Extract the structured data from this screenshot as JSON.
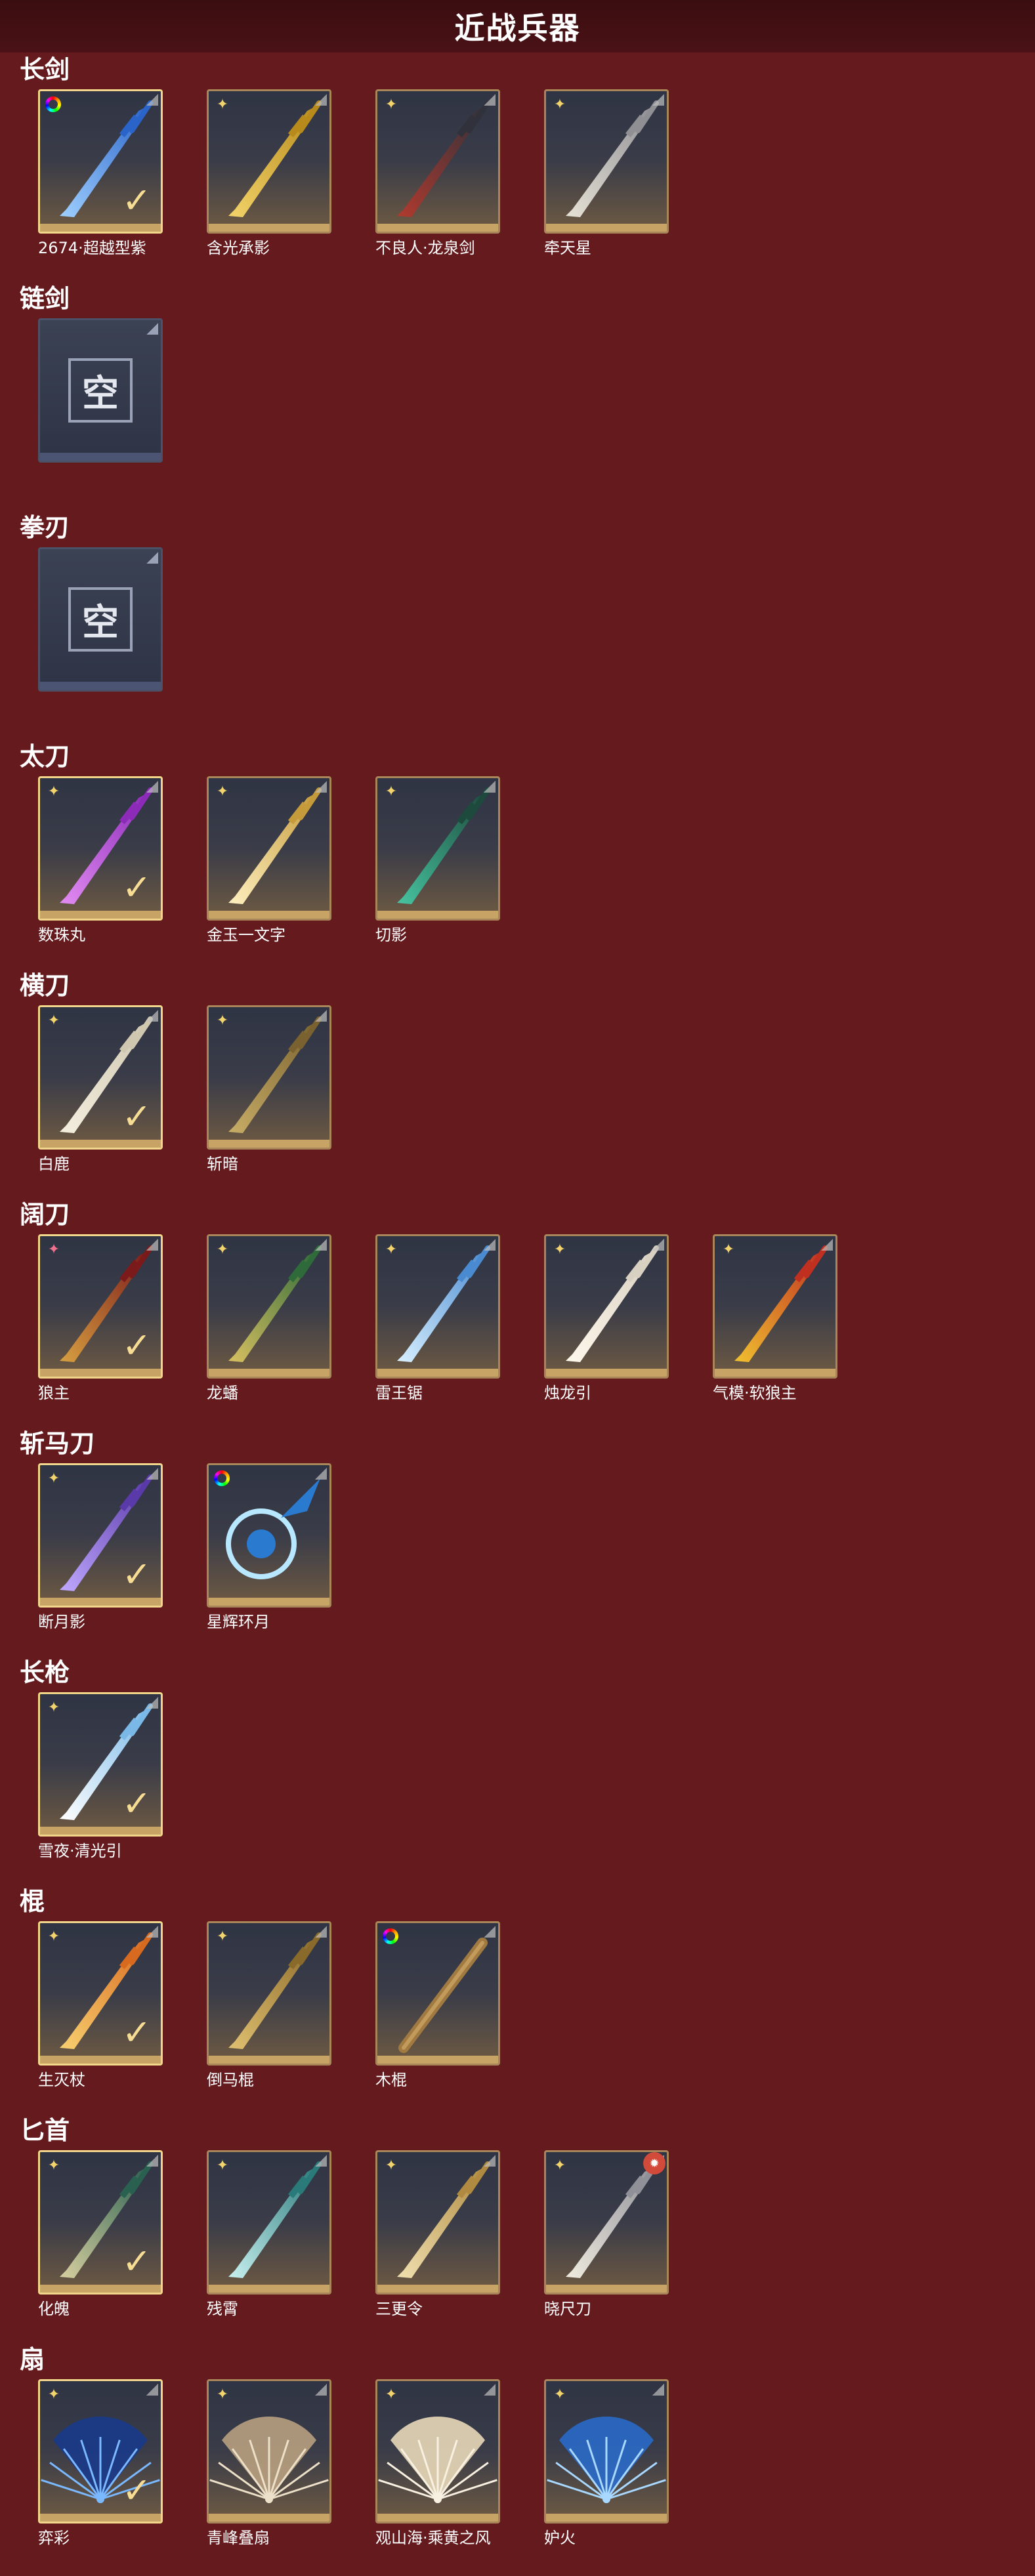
{
  "title": "近战兵器",
  "categories": [
    {
      "name": "长剑",
      "items": [
        {
          "label": "2674·超越型紫",
          "rarity": "rainbow",
          "equipped": true,
          "art": "blue-sword"
        },
        {
          "label": "含光承影",
          "rarity": "gold",
          "equipped": false,
          "art": "gold-sword"
        },
        {
          "label": "不良人·龙泉剑",
          "rarity": "gold",
          "equipped": false,
          "art": "dark-sword"
        },
        {
          "label": "牵天星",
          "rarity": "gold",
          "equipped": false,
          "art": "silver-sword"
        }
      ]
    },
    {
      "name": "链剑",
      "empty_label": "空",
      "items": []
    },
    {
      "name": "拳刃",
      "empty_label": "空",
      "items": []
    },
    {
      "name": "太刀",
      "items": [
        {
          "label": "数珠丸",
          "rarity": "gold",
          "equipped": true,
          "art": "purple-katana"
        },
        {
          "label": "金玉一文字",
          "rarity": "gold",
          "equipped": false,
          "art": "gold-katana"
        },
        {
          "label": "切影",
          "rarity": "gold",
          "equipped": false,
          "art": "green-katana"
        }
      ]
    },
    {
      "name": "横刀",
      "items": [
        {
          "label": "白鹿",
          "rarity": "gold",
          "equipped": true,
          "art": "white-saber"
        },
        {
          "label": "斩暗",
          "rarity": "gold",
          "equipped": false,
          "art": "bronze-saber"
        }
      ]
    },
    {
      "name": "阔刀",
      "items": [
        {
          "label": "狼主",
          "rarity": "pink",
          "equipped": true,
          "art": "red-broad"
        },
        {
          "label": "龙蟠",
          "rarity": "gold",
          "equipped": false,
          "art": "green-broad"
        },
        {
          "label": "雷王锯",
          "rarity": "gold",
          "equipped": false,
          "art": "blue-broad"
        },
        {
          "label": "烛龙引",
          "rarity": "gold",
          "equipped": false,
          "art": "white-broad"
        },
        {
          "label": "气模·软狼主",
          "rarity": "gold",
          "equipped": false,
          "art": "yellow-broad"
        }
      ]
    },
    {
      "name": "斩马刀",
      "items": [
        {
          "label": "断月影",
          "rarity": "gold",
          "equipped": true,
          "art": "purple-glaive"
        },
        {
          "label": "星辉环月",
          "rarity": "rainbow",
          "equipped": false,
          "art": "blue-ring"
        }
      ]
    },
    {
      "name": "长枪",
      "items": [
        {
          "label": "雪夜·清光引",
          "rarity": "gold",
          "equipped": true,
          "art": "ice-spear"
        }
      ]
    },
    {
      "name": "棍",
      "items": [
        {
          "label": "生灭杖",
          "rarity": "gold",
          "equipped": true,
          "art": "fire-staff"
        },
        {
          "label": "倒马棍",
          "rarity": "gold",
          "equipped": false,
          "art": "gold-staff"
        },
        {
          "label": "木棍",
          "rarity": "rainbow",
          "equipped": false,
          "art": "wood-staff"
        }
      ]
    },
    {
      "name": "匕首",
      "items": [
        {
          "label": "化魄",
          "rarity": "gold",
          "equipped": true,
          "art": "green-dagger"
        },
        {
          "label": "残霄",
          "rarity": "gold",
          "equipped": false,
          "art": "teal-dagger"
        },
        {
          "label": "三更令",
          "rarity": "gold",
          "equipped": false,
          "art": "gold-dagger"
        },
        {
          "label": "晓尺刀",
          "rarity": "gold",
          "equipped": false,
          "badge": "new",
          "art": "silver-dagger"
        }
      ]
    },
    {
      "name": "扇",
      "items": [
        {
          "label": "弈彩",
          "rarity": "gold",
          "equipped": true,
          "art": "blue-fan"
        },
        {
          "label": "青峰叠扇",
          "rarity": "gold",
          "equipped": false,
          "art": "beige-fan"
        },
        {
          "label": "观山海·乘黄之风",
          "rarity": "gold",
          "equipped": false,
          "art": "cream-fan"
        },
        {
          "label": "妒火",
          "rarity": "gold",
          "equipped": false,
          "art": "feather-fan"
        }
      ]
    }
  ],
  "colors": {
    "background": "#651a1e",
    "card_border": "#a9865a",
    "equipped_border": "#f0d58a",
    "gold_star": "#f3d36b"
  },
  "icons": {
    "rarity_gold": "four-point-star-icon",
    "rarity_pink": "pink-star-icon",
    "rarity_rainbow": "rainbow-ring-icon",
    "equipped": "check-icon",
    "new": "red-badge-icon"
  }
}
